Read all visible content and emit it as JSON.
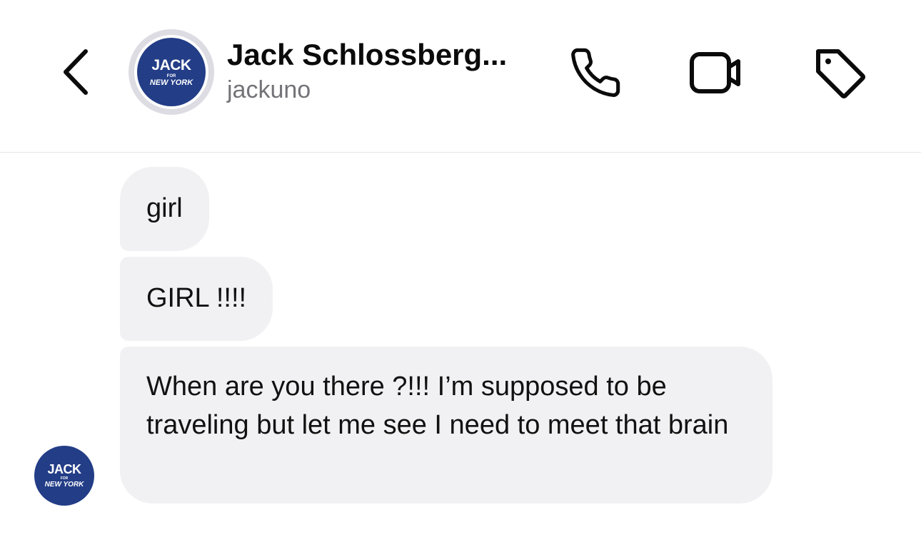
{
  "header": {
    "back_icon": "chevron-left-icon",
    "contact_name": "Jack Schlossberg...",
    "contact_handle": "jackuno",
    "avatar_logo": {
      "line1": "JACK",
      "line2": "FOR",
      "line3": "NEW YORK",
      "background": "#233d87"
    },
    "actions": [
      {
        "icon": "phone-icon"
      },
      {
        "icon": "video-camera-icon"
      },
      {
        "icon": "tag-icon"
      }
    ]
  },
  "messages": [
    {
      "text": "girl"
    },
    {
      "text": "GIRL !!!!"
    },
    {
      "text": "When are you there ?!!! I’m supposed to be traveling but let me see I need to meet that brain"
    }
  ],
  "colors": {
    "bubble_bg": "#f1f1f3",
    "handle_text": "#737378",
    "divider": "#e6e6e8",
    "logo_blue": "#233d87"
  }
}
